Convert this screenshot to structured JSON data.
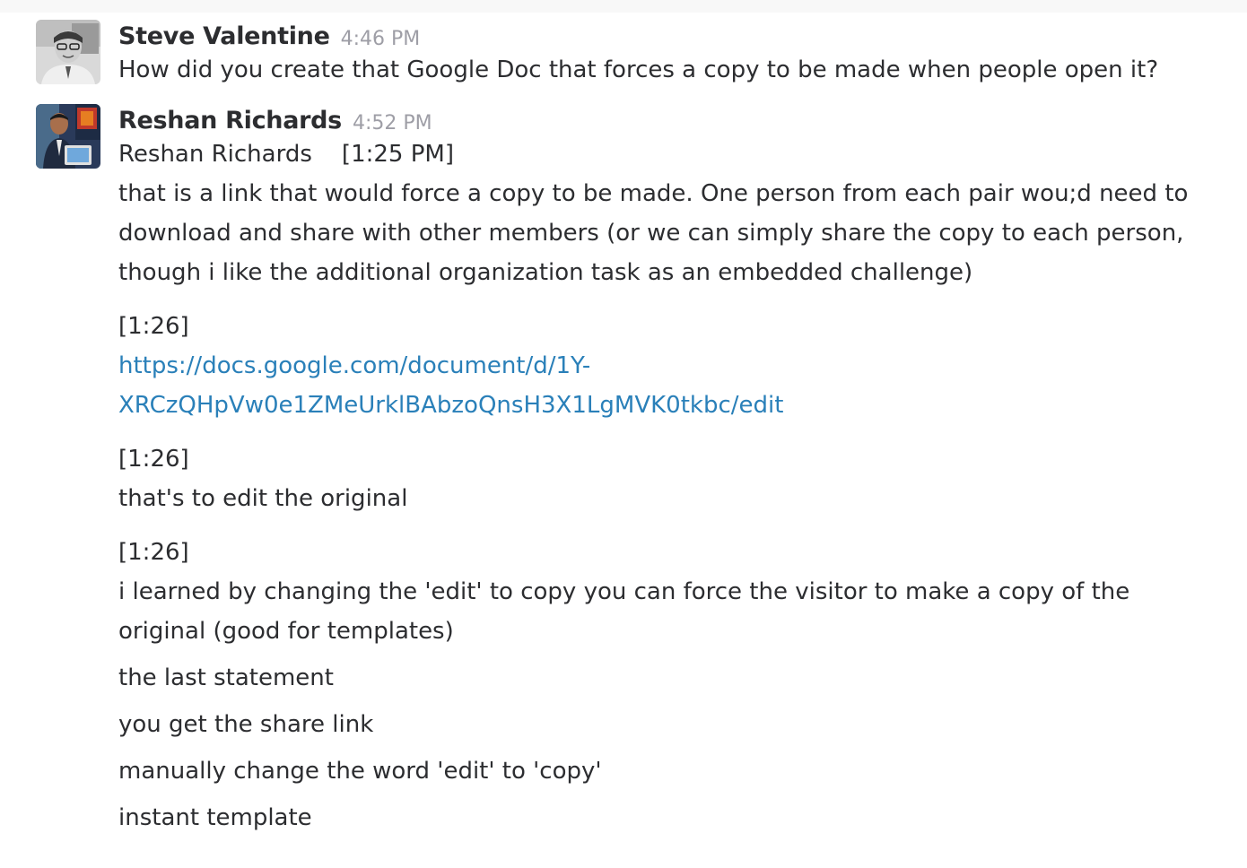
{
  "messages": [
    {
      "sender": "Steve Valentine",
      "time": "4:46 PM",
      "text": "How did you create that Google Doc that forces a copy to be made when people open it?"
    },
    {
      "sender": "Reshan Richards",
      "time": "4:52 PM",
      "quote_header": "Reshan Richards    [1:25 PM]",
      "para1": "that is a link that would force a copy to be made. One person from each pair wou;d need to download and share with other members (or we can simply share the copy to each person, though i  like the additional organization task as an embedded challenge)",
      "ts2": "[1:26]",
      "link_line1": "https://docs.google.com/document/d/1Y-",
      "link_line2": "XRCzQHpVw0e1ZMeUrklBAbzoQnsH3X1LgMVK0tkbc/edit",
      "ts3": "[1:26]",
      "edit_original": "that's to edit the original",
      "ts4": "[1:26]",
      "para2": "i learned by changing the 'edit' to copy you can force the visitor to make a copy of the original (good for templates)",
      "followups": [
        "the last statement",
        "you get the share link",
        "manually change the word 'edit' to 'copy'",
        "instant template"
      ]
    }
  ],
  "colors": {
    "link": "#2a80b9",
    "text": "#2c2d30",
    "timestamp": "#9e9ea6"
  },
  "icons": {
    "steve_avatar": "avatar-photo",
    "reshan_avatar": "avatar-photo"
  }
}
